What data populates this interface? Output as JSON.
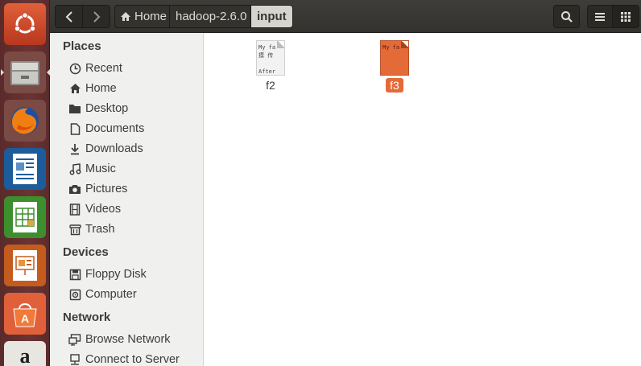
{
  "header": {
    "back_label": "‹",
    "forward_label": "›",
    "breadcrumbs": [
      "Home",
      "hadoop-2.6.0",
      "input"
    ]
  },
  "launcher": [
    {
      "name": "ubuntu-dash-icon"
    },
    {
      "name": "files-icon"
    },
    {
      "name": "firefox-icon"
    },
    {
      "name": "libreoffice-writer-icon"
    },
    {
      "name": "libreoffice-calc-icon"
    },
    {
      "name": "libreoffice-impress-icon"
    },
    {
      "name": "software-center-icon"
    },
    {
      "name": "amazon-icon"
    }
  ],
  "sidebar": {
    "places_heading": "Places",
    "places": [
      {
        "label": "Recent",
        "icon": "clock-icon"
      },
      {
        "label": "Home",
        "icon": "home-icon"
      },
      {
        "label": "Desktop",
        "icon": "folder-icon"
      },
      {
        "label": "Documents",
        "icon": "document-icon"
      },
      {
        "label": "Downloads",
        "icon": "download-icon"
      },
      {
        "label": "Music",
        "icon": "music-icon"
      },
      {
        "label": "Pictures",
        "icon": "camera-icon"
      },
      {
        "label": "Videos",
        "icon": "film-icon"
      },
      {
        "label": "Trash",
        "icon": "trash-icon"
      }
    ],
    "devices_heading": "Devices",
    "devices": [
      {
        "label": "Floppy Disk",
        "icon": "floppy-icon"
      },
      {
        "label": "Computer",
        "icon": "computer-icon"
      }
    ],
    "network_heading": "Network",
    "network": [
      {
        "label": "Browse Network",
        "icon": "network-icon"
      },
      {
        "label": "Connect to Server",
        "icon": "server-icon"
      }
    ]
  },
  "files": [
    {
      "name": "f2",
      "preview": [
        "My fa",
        "摸 传",
        "",
        "After"
      ],
      "selected": false
    },
    {
      "name": "f3",
      "preview": [
        "My fa"
      ],
      "selected": true
    }
  ],
  "colors": {
    "selection": "#e46a38",
    "launcher": "#5a2a2a",
    "headerbar": "#3b3a36"
  }
}
